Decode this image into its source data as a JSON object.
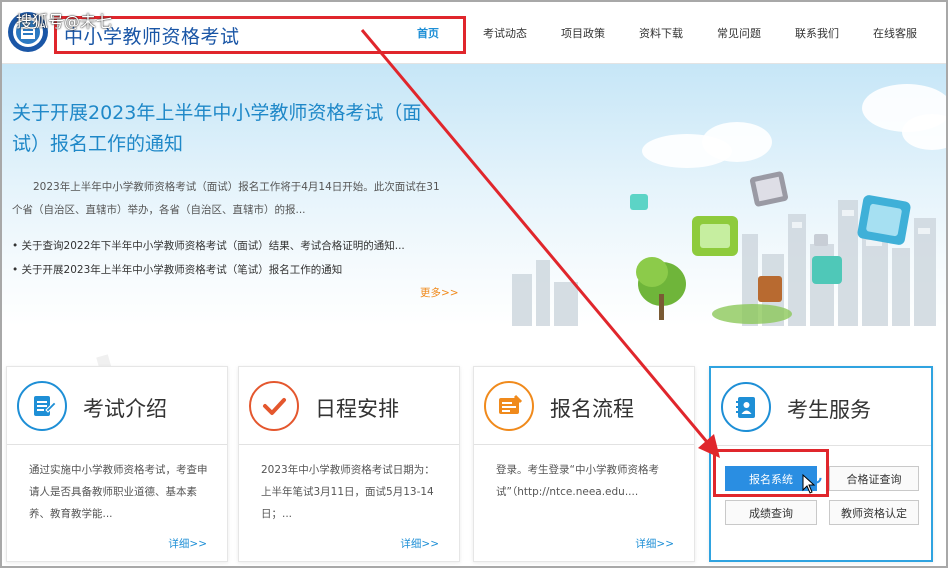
{
  "watermark": "搜狐号@未七",
  "header": {
    "title": "中小学教师资格考试",
    "nav": [
      {
        "label": "首页",
        "active": true
      },
      {
        "label": "考试动态"
      },
      {
        "label": "项目政策"
      },
      {
        "label": "资料下载"
      },
      {
        "label": "常见问题"
      },
      {
        "label": "联系我们"
      },
      {
        "label": "在线客服"
      }
    ]
  },
  "banner": {
    "title": "关于开展2023年上半年中小学教师资格考试（面试）报名工作的通知",
    "description": "2023年上半年中小学教师资格考试（面试）报名工作将于4月14日开始。此次面试在31个省（自治区、直辖市）举办，各省（自治区、直辖市）的报...",
    "links": [
      "关于查询2022年下半年中小学教师资格考试（面试）结果、考试合格证明的通知...",
      "关于开展2023年上半年中小学教师资格考试（笔试）报名工作的通知"
    ],
    "more": "更多>>"
  },
  "cards": [
    {
      "title": "考试介绍",
      "icon": "document-icon",
      "text": "通过实施中小学教师资格考试，考查申请人是否具备教师职业道德、基本素养、教育教学能...",
      "detail": "详细>>"
    },
    {
      "title": "日程安排",
      "icon": "checkmark-icon",
      "text": "2023年中小学教师资格考试日期为：上半年笔试3月11日，面试5月13-14日；...",
      "detail": "详细>>"
    },
    {
      "title": "报名流程",
      "icon": "form-icon",
      "text": "登录。考生登录“中小学教师资格考试”（http://ntce.neea.edu....",
      "detail": "详细>>"
    }
  ],
  "service": {
    "title": "考生服务",
    "icon": "contacts-book-icon",
    "buttons": [
      "报名系统",
      "合格证查询",
      "成绩查询",
      "教师资格认定"
    ]
  },
  "colors": {
    "brand_blue": "#1e8fd6",
    "title_blue": "#1a56a6",
    "annotation_red": "#e0262c",
    "more_orange": "#f08a1c"
  }
}
